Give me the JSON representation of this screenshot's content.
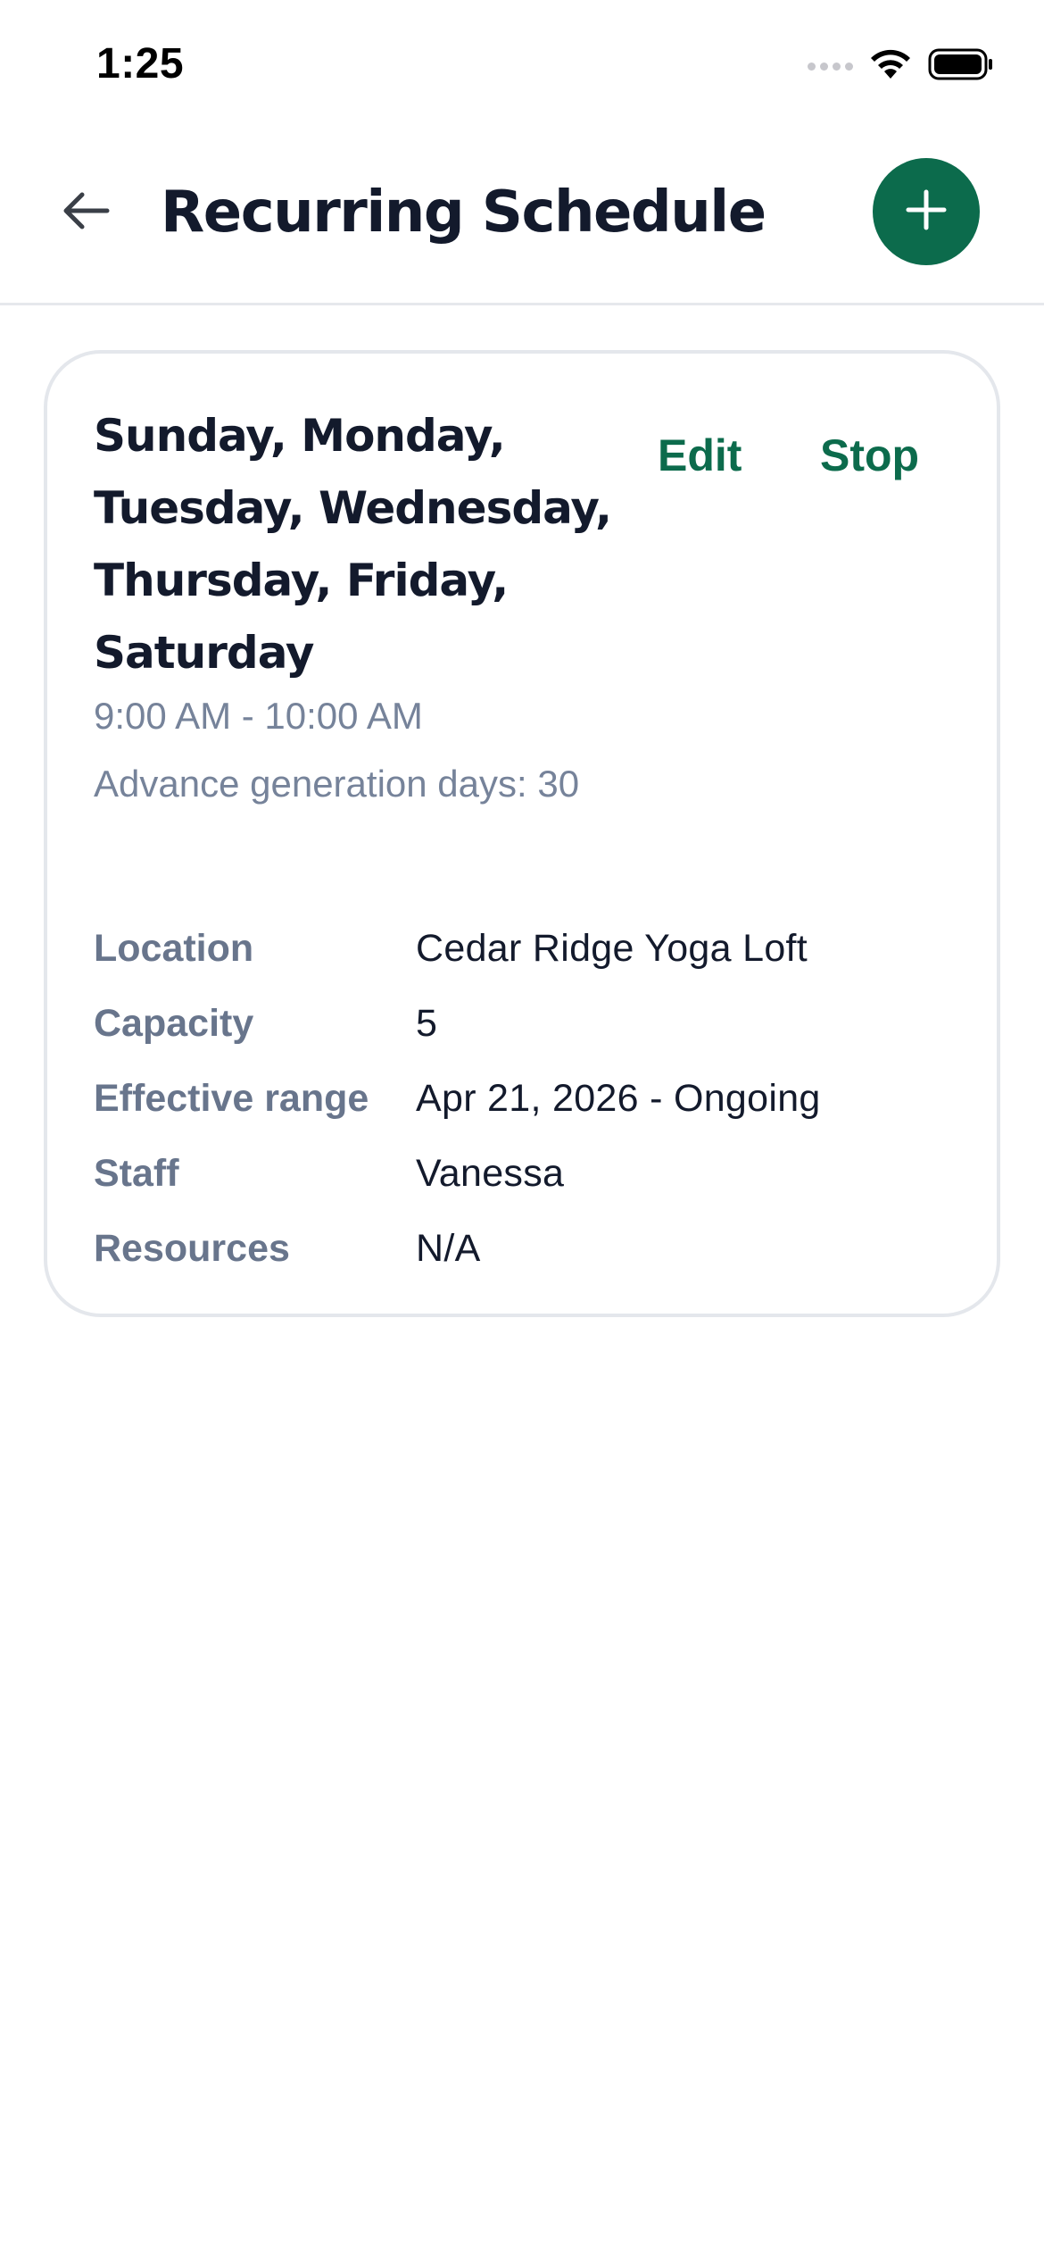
{
  "status_bar": {
    "time": "1:25",
    "icons": [
      "cellular-dots-icon",
      "wifi-icon",
      "battery-icon"
    ]
  },
  "header": {
    "title": "Recurring Schedule",
    "back_icon": "arrow-left-icon",
    "add_icon": "plus-icon"
  },
  "colors": {
    "accent": "#0c6b4c",
    "title_text": "#131a2c",
    "muted_text": "#76839a",
    "label_text": "#68758c",
    "border": "#e4e7ec"
  },
  "schedule": {
    "days": "Sunday, Monday, Tuesday, Wednesday, Thursday, Friday, Saturday",
    "edit_label": "Edit",
    "stop_label": "Stop",
    "time_range": "9:00 AM - 10:00 AM",
    "advance_generation": "Advance generation days: 30",
    "details": [
      {
        "label": "Location",
        "value": "Cedar Ridge Yoga Loft"
      },
      {
        "label": "Capacity",
        "value": "5"
      },
      {
        "label": "Effective range",
        "value": "Apr 21, 2026 - Ongoing"
      },
      {
        "label": "Staff",
        "value": "Vanessa"
      },
      {
        "label": "Resources",
        "value": "N/A"
      }
    ]
  }
}
